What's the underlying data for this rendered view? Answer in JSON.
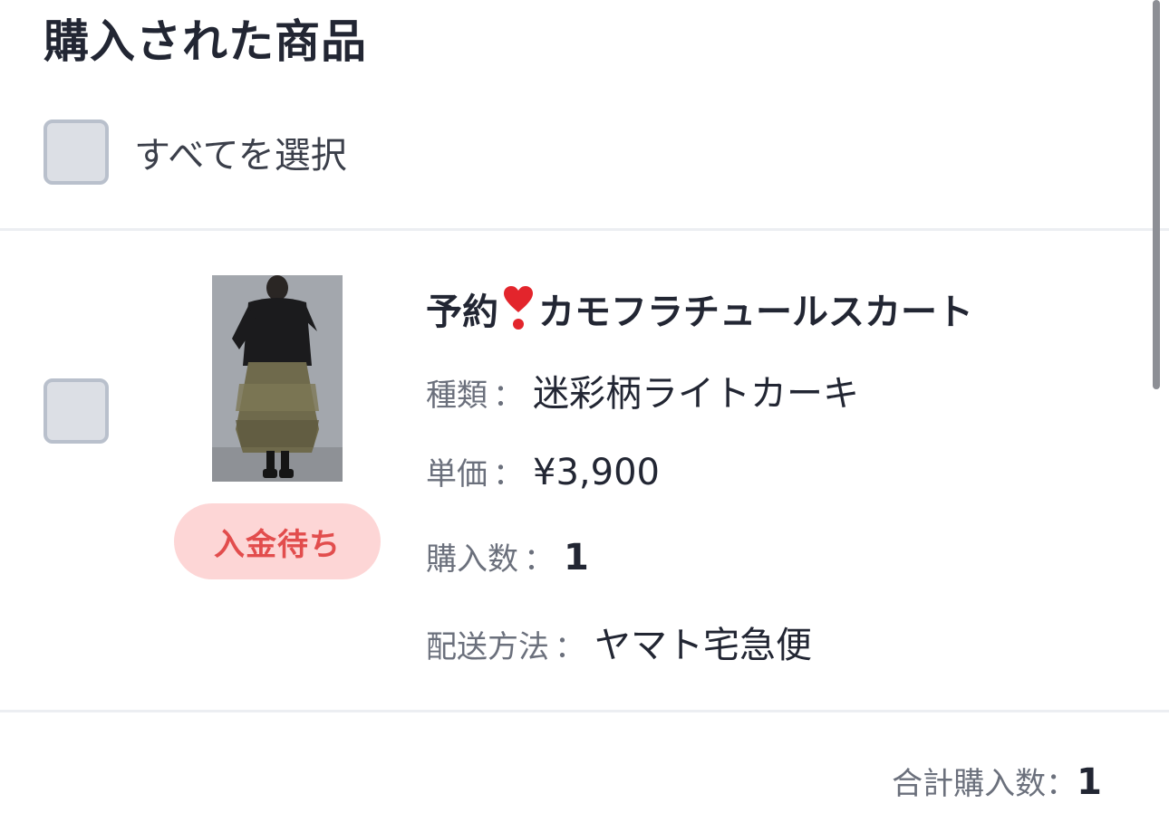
{
  "section": {
    "title": "購入された商品",
    "select_all_label": "すべてを選択"
  },
  "item": {
    "name_part1": "予約",
    "name_icon": "heavy-exclamation-heart-icon",
    "name_part2": "カモフラチュールスカート",
    "status": "入金待ち",
    "kind_label": "種類",
    "kind_value": "迷彩柄ライトカーキ",
    "price_label": "単価",
    "price_value": "¥3,900",
    "qty_label": "購入数",
    "qty_value": "1",
    "ship_label": "配送方法",
    "ship_value": "ヤマト宅急便",
    "separator": "："
  },
  "summary": {
    "total_label": "合計購入数：",
    "total_value": "1"
  },
  "colors": {
    "status_bg": "#fdd6d6",
    "status_text": "#e24d4d",
    "checkbox_fill": "#dcdfe5",
    "checkbox_border": "#b9c0cc"
  }
}
